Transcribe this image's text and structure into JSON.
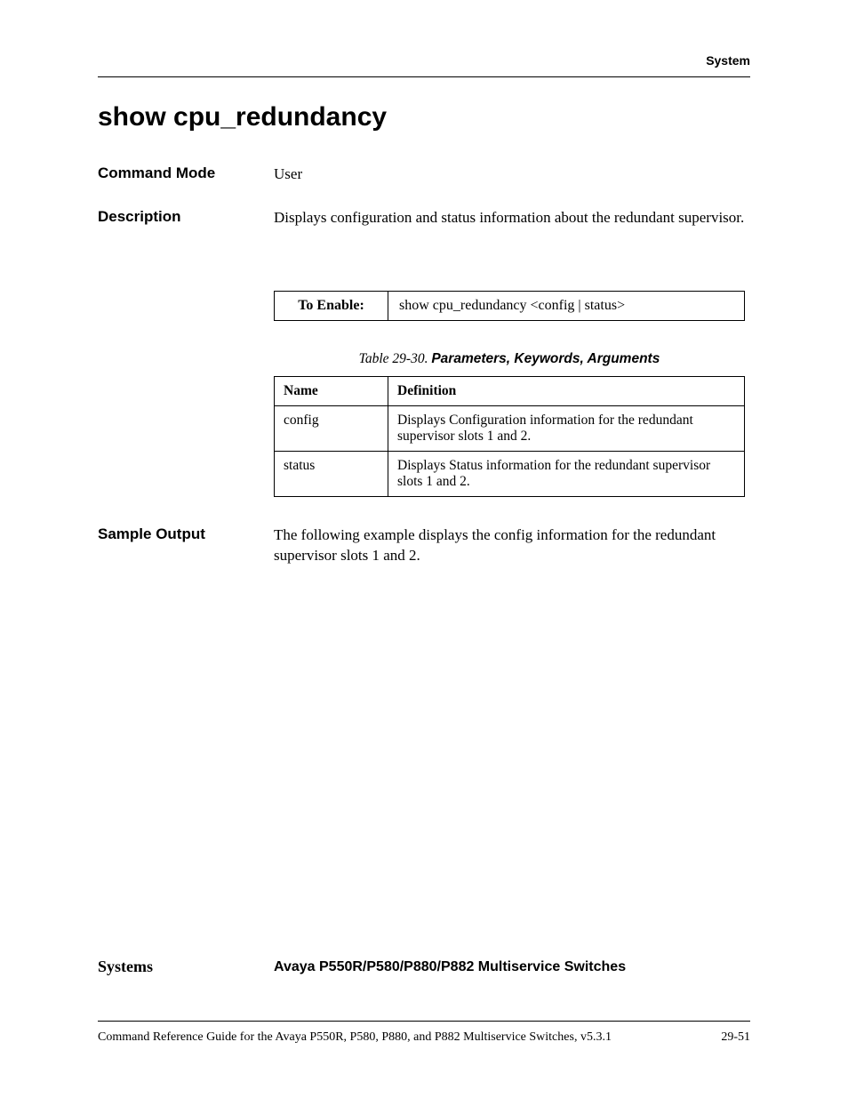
{
  "header": {
    "section": "System"
  },
  "title": "show cpu_redundancy",
  "commandMode": {
    "label": "Command Mode",
    "value": "User"
  },
  "description": {
    "label": "Description",
    "value": "Displays configuration and status information about the redundant supervisor."
  },
  "syntax": {
    "key": "To Enable:",
    "value": "show cpu_redundancy <config | status>"
  },
  "tableCaption": {
    "prefix": "Table 29-30.",
    "title": " Parameters, Keywords, Arguments"
  },
  "paramsTable": {
    "headers": {
      "name": "Name",
      "definition": "Definition"
    },
    "rows": [
      {
        "name": "config",
        "definition": "Displays Configuration information for the redundant supervisor slots 1 and 2."
      },
      {
        "name": "status",
        "definition": "Displays Status information for the redundant supervisor slots 1 and 2."
      }
    ]
  },
  "sampleOutput": {
    "label": "Sample Output",
    "value": "The following example displays the config information for the redundant supervisor slots 1 and 2."
  },
  "systems": {
    "label": "Systems",
    "value": "Avaya P550R/P580/P880/P882 Multiservice Switches"
  },
  "footer": {
    "left": "Command Reference Guide for the Avaya P550R, P580, P880, and P882 Multiservice Switches, v5.3.1",
    "right": "29-51"
  }
}
